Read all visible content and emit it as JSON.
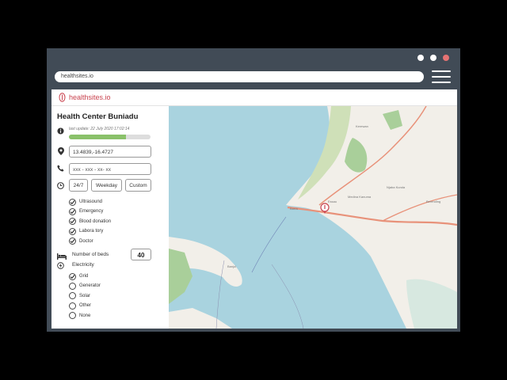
{
  "browser": {
    "url": "healthsites.io",
    "dot_colors": [
      "#ffffff",
      "#ffffff",
      "#e57373"
    ]
  },
  "header": {
    "logo_text": "healthsites.io"
  },
  "facility": {
    "name": "Health Center Buniadu",
    "last_update": "last update: 22 July 2020 17:02:14",
    "completeness": 0.7,
    "coordinates": "13.4839,-16.4727",
    "phone_placeholder": "xxx - xxx - xx- xx",
    "hours_options": [
      "24/7",
      "Weekday",
      "Custom"
    ],
    "services": [
      {
        "label": "Ultrasound",
        "checked": true
      },
      {
        "label": "Emergency",
        "checked": true
      },
      {
        "label": "Blood donation",
        "checked": true
      },
      {
        "label": "Labora tory",
        "checked": true
      },
      {
        "label": "Doctor",
        "checked": true
      }
    ],
    "beds_label": "Number of beds",
    "beds_value": "40",
    "electricity_label": "Electricity",
    "electricity": [
      {
        "label": "Grid",
        "checked": true
      },
      {
        "label": "Generator",
        "checked": false
      },
      {
        "label": "Solar",
        "checked": false
      },
      {
        "label": "Other",
        "checked": false
      },
      {
        "label": "None",
        "checked": false
      }
    ]
  },
  "map": {
    "labels": [
      "Barra",
      "Banjul",
      "Essau",
      "Medina Kanuma",
      "Kerewan",
      "Njaba Kunda",
      "Berending"
    ],
    "colors": {
      "sea": "#a9d3df",
      "land": "#f2efe9",
      "green": "#a9cf9a",
      "road": "#e8927a",
      "marker": "#c9434f"
    }
  }
}
